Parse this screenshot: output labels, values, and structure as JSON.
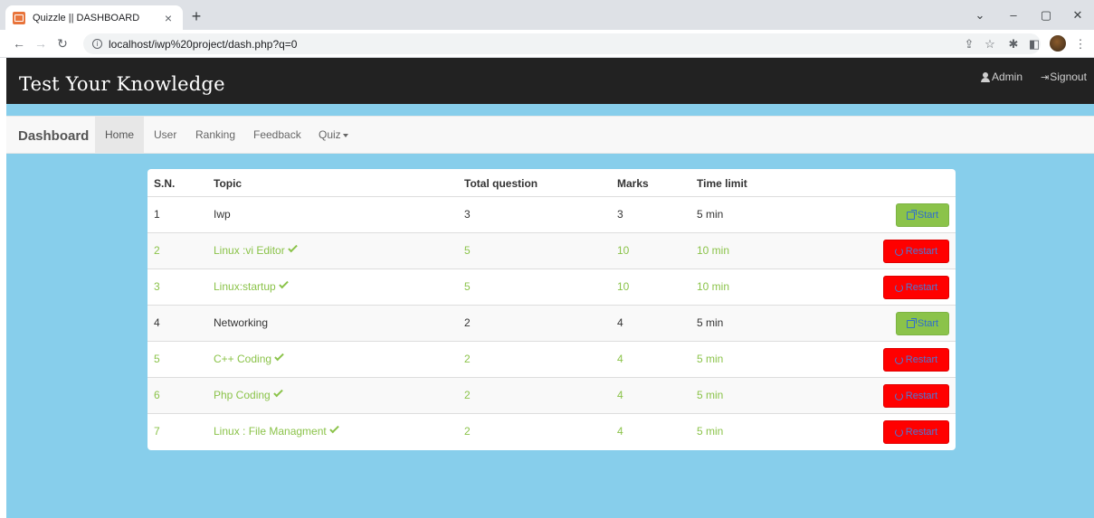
{
  "browser": {
    "tab_title": "Quizzle || DASHBOARD",
    "tab_close": "×",
    "new_tab": "+",
    "url": "localhost/iwp%20project/dash.php?q=0",
    "win_minimize": "–",
    "win_restore": "▢",
    "win_close": "✕",
    "win_dropdown": "⌄"
  },
  "header": {
    "site_title": "Test Your Knowledge",
    "admin_label": "Admin",
    "signout_label": "Signout"
  },
  "nav": {
    "brand": "Dashboard",
    "items": [
      "Home",
      "User",
      "Ranking",
      "Feedback",
      "Quiz"
    ],
    "active": "Home"
  },
  "table": {
    "headers": [
      "S.N.",
      "Topic",
      "Total question",
      "Marks",
      "Time limit"
    ],
    "rows": [
      {
        "sn": "1",
        "topic": "Iwp",
        "total": "3",
        "marks": "3",
        "time": "5 min",
        "taken": false,
        "action": "Start"
      },
      {
        "sn": "2",
        "topic": "Linux :vi Editor",
        "total": "5",
        "marks": "10",
        "time": "10 min",
        "taken": true,
        "action": "Restart"
      },
      {
        "sn": "3",
        "topic": "Linux:startup",
        "total": "5",
        "marks": "10",
        "time": "10 min",
        "taken": true,
        "action": "Restart"
      },
      {
        "sn": "4",
        "topic": "Networking",
        "total": "2",
        "marks": "4",
        "time": "5 min",
        "taken": false,
        "action": "Start"
      },
      {
        "sn": "5",
        "topic": "C++ Coding",
        "total": "2",
        "marks": "4",
        "time": "5 min",
        "taken": true,
        "action": "Restart"
      },
      {
        "sn": "6",
        "topic": "Php Coding",
        "total": "2",
        "marks": "4",
        "time": "5 min",
        "taken": true,
        "action": "Restart"
      },
      {
        "sn": "7",
        "topic": "Linux : File Managment",
        "total": "2",
        "marks": "4",
        "time": "5 min",
        "taken": true,
        "action": "Restart"
      }
    ]
  },
  "colors": {
    "page_background": "#87ceeb",
    "header_background": "#222222",
    "taken_text": "#8bc34a",
    "start_button": "#8bc34a",
    "restart_button": "#ff0000"
  },
  "icons": {
    "admin": "user-icon",
    "signout": "signout-icon",
    "start": "external-link-icon",
    "restart": "refresh-icon",
    "completed": "check-icon"
  }
}
